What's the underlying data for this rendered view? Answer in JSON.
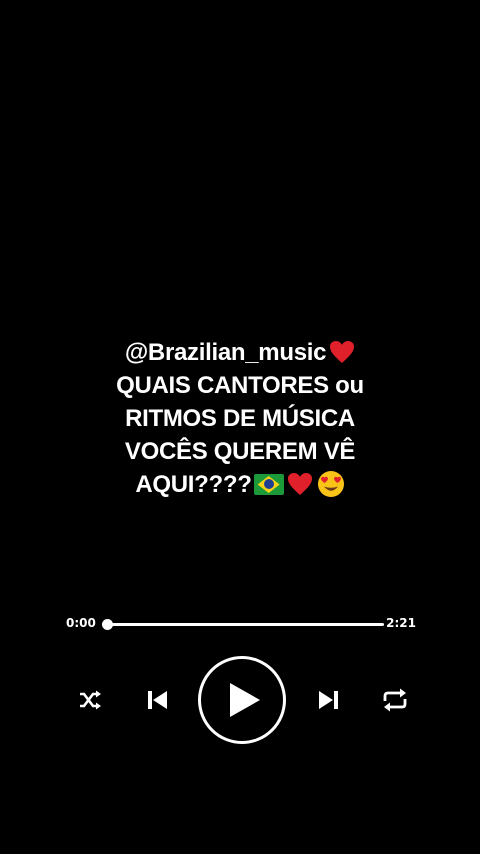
{
  "caption": {
    "line1_text": "@Brazilian_music",
    "line2": "QUAIS CANTORES ou",
    "line3": "RITMOS DE MÚSICA",
    "line4": "VOCÊS QUEREM VÊ",
    "line5_text": "AQUI????",
    "emoji_after_line1": "red-heart-icon",
    "emojis_after_line5": [
      "brazil-flag-icon",
      "red-heart-icon",
      "heart-eyes-icon"
    ]
  },
  "player": {
    "current_time": "0:00",
    "total_time": "2:21",
    "progress_fraction": 0.0,
    "buttons": [
      "shuffle-icon",
      "previous-icon",
      "play-icon",
      "next-icon",
      "repeat-icon"
    ]
  },
  "colors": {
    "background": "#000000",
    "foreground": "#ffffff",
    "heart": "#e0202a"
  }
}
